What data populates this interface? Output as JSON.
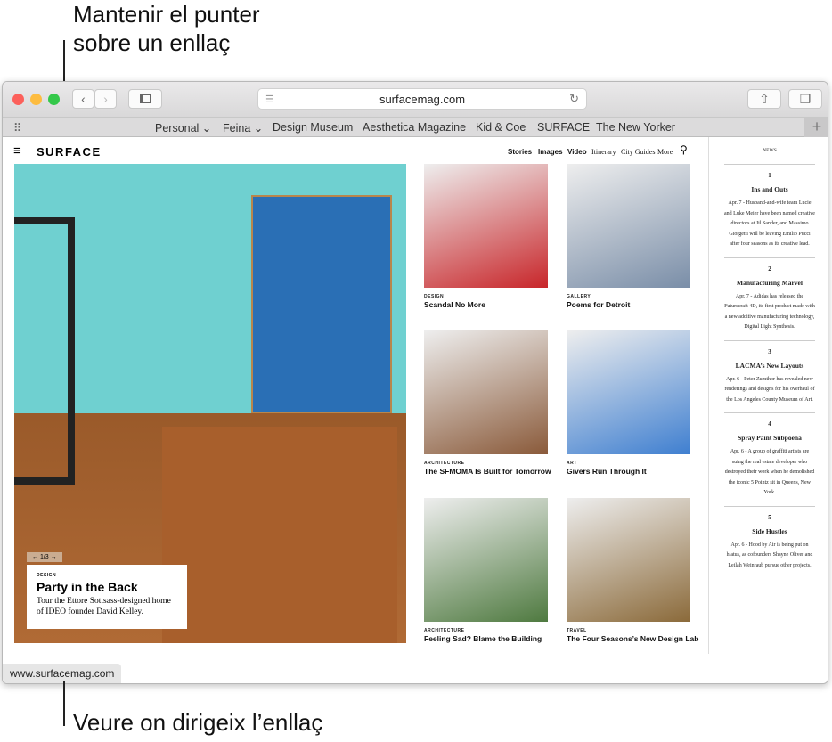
{
  "callouts": {
    "top_line1": "Mantenir el punter",
    "top_line2": "sobre un enllaç",
    "bottom": "Veure on dirigeix l’enllaç"
  },
  "browser": {
    "url": "surfacemag.com",
    "status_url": "www.surfacemag.com",
    "bookmarks": [
      "Personal ⌄",
      "Feina ⌄",
      "Design Museum",
      "Aesthetica Magazine",
      "Kid & Coe",
      "SURFACE",
      "The New Yorker"
    ]
  },
  "site": {
    "logo": "SURFACE",
    "nav": [
      "Stories",
      "Images",
      "Video",
      "Itinerary",
      "City Guides",
      "More"
    ],
    "hero": {
      "pager": "← 1/3 →",
      "category": "DESIGN",
      "title": "Party in the Back",
      "desc": "Tour the Ettore Sottsass-designed home of IDEO founder David Kelley."
    },
    "cards": [
      {
        "category": "DESIGN",
        "title": "Scandal No More",
        "color": "#c8262a"
      },
      {
        "category": "GALLERY",
        "title": "Poems for Detroit",
        "color": "#7a8ea8"
      },
      {
        "category": "ARCHITECTURE",
        "title": "The SFMOMA Is Built for Tomorrow",
        "color": "#8a5a3a"
      },
      {
        "category": "ART",
        "title": "Givers Run Through It",
        "color": "#3f7fd0"
      },
      {
        "category": "ARCHITECTURE",
        "title": "Feeling Sad? Blame the Building",
        "color": "#4f7a40"
      },
      {
        "category": "TRAVEL",
        "title": "The Four Seasons’s New Design Lab",
        "color": "#8b6a3a"
      }
    ],
    "news_label": "NEWS",
    "news": [
      {
        "num": "1",
        "title": "Ins and Outs",
        "body": "Apr. 7 - Husband-and-wife team Lucie and Luke Meier have been named creative directors at Jil Sander, and Massimo Giorgetti will be leaving Emilio Pucci after four seasons as its creative lead."
      },
      {
        "num": "2",
        "title": "Manufacturing Marvel",
        "body": "Apr. 7 - Adidas has released the Futurecraft 4D, its first product made with a new additive manufacturing technology, Digital Light Synthesis."
      },
      {
        "num": "3",
        "title": "LACMA’s New Layouts",
        "body": "Apr. 6 - Peter Zumthor has revealed new renderings and designs for his overhaul of the Los Angeles County Museum of Art."
      },
      {
        "num": "4",
        "title": "Spray Paint Subpoena",
        "body": "Apr. 6 - A group of graffiti artists are suing the real estate developer who destroyed their work when he demolished the iconic 5 Pointz sit in Queens, New York."
      },
      {
        "num": "5",
        "title": "Side Hustles",
        "body": "Apr. 6 - Hood by Air is being put on hiatus, as cofounders Shayne Oliver and Leilah Weinraub pursue other projects."
      }
    ]
  }
}
